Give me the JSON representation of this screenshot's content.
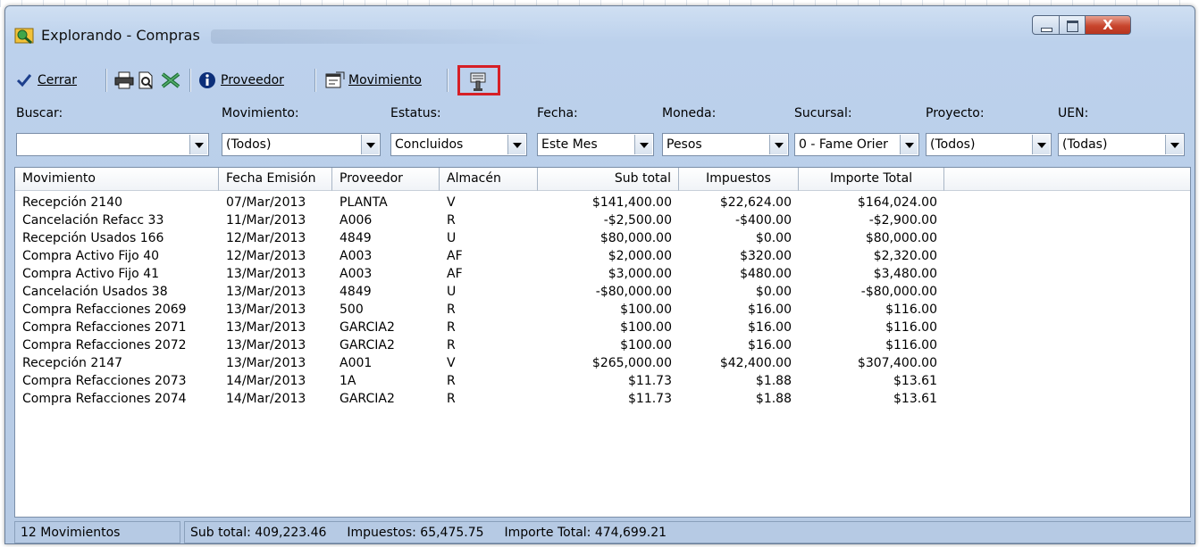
{
  "window": {
    "title": "Explorando - Compras",
    "close_glyph": "X"
  },
  "toolbar": {
    "cerrar_label": "Cerrar",
    "proveedor_label": "Proveedor",
    "movimiento_label": "Movimiento",
    "icons": [
      "checkmark-icon",
      "printer-icon",
      "print-preview-icon",
      "excel-icon",
      "info-icon",
      "properties-icon",
      "filter-tool-icon"
    ]
  },
  "filters": {
    "buscar": {
      "label": "Buscar:",
      "value": ""
    },
    "movimiento": {
      "label": "Movimiento:",
      "value": "(Todos)"
    },
    "estatus": {
      "label": "Estatus:",
      "value": "Concluidos"
    },
    "fecha": {
      "label": "Fecha:",
      "value": "Este Mes"
    },
    "moneda": {
      "label": "Moneda:",
      "value": "Pesos"
    },
    "sucursal": {
      "label": "Sucursal:",
      "value": "0 - Fame Orier"
    },
    "proyecto": {
      "label": "Proyecto:",
      "value": "(Todos)"
    },
    "uen": {
      "label": "UEN:",
      "value": "(Todas)"
    }
  },
  "table": {
    "columns": [
      "Movimiento",
      "Fecha Emisión",
      "Proveedor",
      "Almacén",
      "Sub total",
      "Impuestos",
      "Importe Total"
    ],
    "rows": [
      [
        "Recepción 2140",
        "07/Mar/2013",
        "PLANTA",
        "V",
        "$141,400.00",
        "$22,624.00",
        "$164,024.00"
      ],
      [
        "Cancelación Refacc 33",
        "11/Mar/2013",
        "A006",
        "R",
        "-$2,500.00",
        "-$400.00",
        "-$2,900.00"
      ],
      [
        "Recepción Usados 166",
        "12/Mar/2013",
        "4849",
        "U",
        "$80,000.00",
        "$0.00",
        "$80,000.00"
      ],
      [
        "Compra Activo Fijo 40",
        "12/Mar/2013",
        "A003",
        "AF",
        "$2,000.00",
        "$320.00",
        "$2,320.00"
      ],
      [
        "Compra Activo Fijo 41",
        "13/Mar/2013",
        "A003",
        "AF",
        "$3,000.00",
        "$480.00",
        "$3,480.00"
      ],
      [
        "Cancelación Usados 38",
        "13/Mar/2013",
        "4849",
        "U",
        "-$80,000.00",
        "$0.00",
        "-$80,000.00"
      ],
      [
        "Compra Refacciones 2069",
        "13/Mar/2013",
        "500",
        "R",
        "$100.00",
        "$16.00",
        "$116.00"
      ],
      [
        "Compra Refacciones 2071",
        "13/Mar/2013",
        "GARCIA2",
        "R",
        "$100.00",
        "$16.00",
        "$116.00"
      ],
      [
        "Compra Refacciones 2072",
        "13/Mar/2013",
        "GARCIA2",
        "R",
        "$100.00",
        "$16.00",
        "$116.00"
      ],
      [
        "Recepción 2147",
        "13/Mar/2013",
        "A001",
        "V",
        "$265,000.00",
        "$42,400.00",
        "$307,400.00"
      ],
      [
        "Compra Refacciones 2073",
        "14/Mar/2013",
        "1A",
        "R",
        "$11.73",
        "$1.88",
        "$13.61"
      ],
      [
        "Compra Refacciones 2074",
        "14/Mar/2013",
        "GARCIA2",
        "R",
        "$11.73",
        "$1.88",
        "$13.61"
      ]
    ]
  },
  "status": {
    "count": "12 Movimientos",
    "subtotal": "Sub total: 409,223.46",
    "impuestos": "Impuestos: 65,475.75",
    "importe_total": "Importe Total: 474,699.21"
  },
  "colors": {
    "highlight": "#d61f26",
    "titlebar": "#c4d6ee",
    "close": "#c8452d"
  }
}
